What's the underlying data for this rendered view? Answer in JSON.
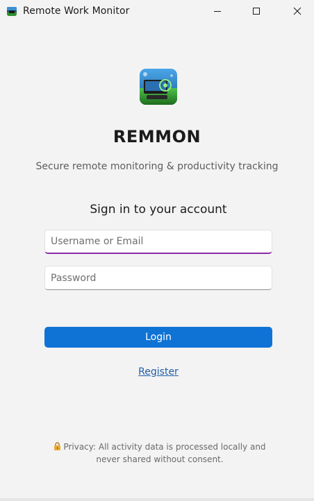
{
  "window": {
    "title": "Remote Work Monitor",
    "controls": {
      "minimize_icon": "minimize-icon",
      "maximize_icon": "maximize-icon",
      "close_icon": "close-icon"
    }
  },
  "branding": {
    "logo_icon": "app-logo-icon",
    "name": "REMMON",
    "tagline": "Secure remote monitoring & productivity tracking"
  },
  "form": {
    "heading": "Sign in to your account",
    "username": {
      "value": "",
      "placeholder": "Username or Email"
    },
    "password": {
      "value": "",
      "placeholder": "Password"
    },
    "login_label": "Login",
    "register_label": "Register"
  },
  "footer": {
    "lock_icon": "lock-icon",
    "privacy_text": "Privacy: All activity data is processed locally and never shared without consent."
  },
  "colors": {
    "background": "#f3f3f3",
    "accent": "#0f73d6",
    "focus_underline": "#8a2ba8",
    "link": "#1f5ea8"
  }
}
